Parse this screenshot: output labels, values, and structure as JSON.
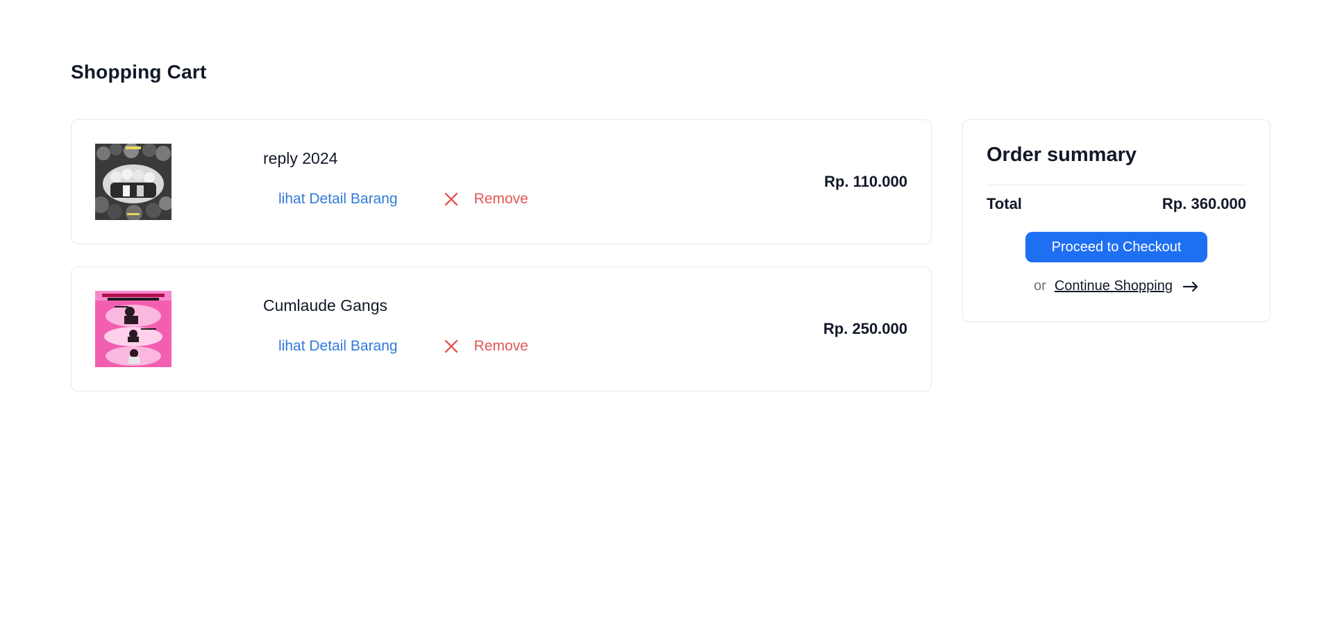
{
  "page": {
    "title": "Shopping Cart"
  },
  "cart": {
    "items": [
      {
        "name": "reply 2024",
        "detail_link": "lihat Detail Barang",
        "remove_label": "Remove",
        "price": "Rp. 110.000",
        "thumb_icon": "group-photo-thumbnail"
      },
      {
        "name": "Cumlaude Gangs",
        "detail_link": "lihat Detail Barang",
        "remove_label": "Remove",
        "price": "Rp. 250.000",
        "thumb_icon": "pink-poster-thumbnail"
      }
    ]
  },
  "summary": {
    "title": "Order summary",
    "total_label": "Total",
    "total_value": "Rp. 360.000",
    "checkout_label": "Proceed to Checkout",
    "or_text": "or",
    "continue_label": "Continue Shopping",
    "continue_icon": "arrow-right-icon"
  },
  "colors": {
    "link": "#2f7bd9",
    "remove": "#e25555",
    "primary": "#1f6ff2",
    "text": "#111827",
    "border": "#e5e7eb"
  }
}
